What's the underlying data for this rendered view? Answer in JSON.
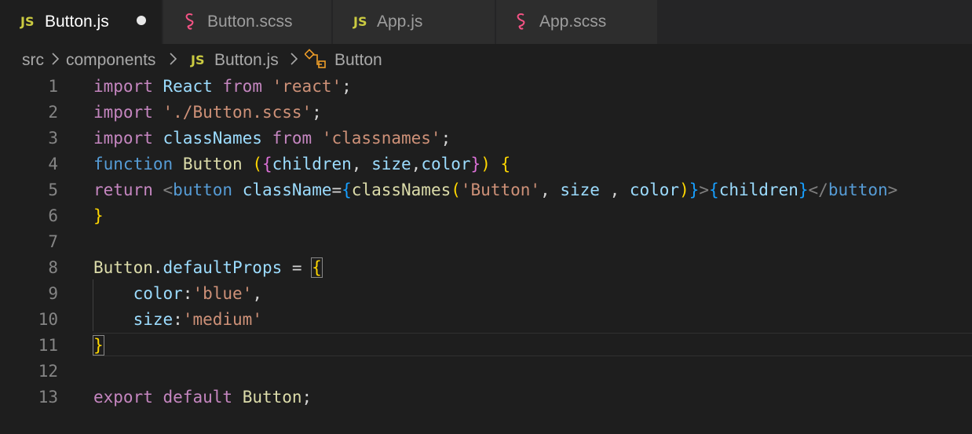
{
  "tabs": [
    {
      "label": "Button.js",
      "icon": "js-icon",
      "active": true,
      "modified": true,
      "icon_text": "JS"
    },
    {
      "label": "Button.scss",
      "icon": "scss-icon",
      "active": false
    },
    {
      "label": "App.js",
      "icon": "js-icon",
      "active": false,
      "icon_text": "JS"
    },
    {
      "label": "App.scss",
      "icon": "scss-icon",
      "active": false
    }
  ],
  "breadcrumb": {
    "parts": [
      "src",
      "components",
      "Button.js",
      "Button"
    ],
    "file_icon_text": "JS"
  },
  "editor": {
    "line_numbers": [
      "1",
      "2",
      "3",
      "4",
      "5",
      "6",
      "7",
      "8",
      "9",
      "10",
      "11",
      "12",
      "13"
    ],
    "lines": [
      [
        [
          "kw",
          "import"
        ],
        [
          "pun",
          " "
        ],
        [
          "var",
          "React"
        ],
        [
          "pun",
          " "
        ],
        [
          "kw",
          "from"
        ],
        [
          "pun",
          " "
        ],
        [
          "str",
          "'react'"
        ],
        [
          "pun",
          ";"
        ]
      ],
      [
        [
          "kw",
          "import"
        ],
        [
          "pun",
          " "
        ],
        [
          "str",
          "'./Button.scss'"
        ],
        [
          "pun",
          ";"
        ]
      ],
      [
        [
          "kw",
          "import"
        ],
        [
          "pun",
          " "
        ],
        [
          "var",
          "classNames"
        ],
        [
          "pun",
          " "
        ],
        [
          "kw",
          "from"
        ],
        [
          "pun",
          " "
        ],
        [
          "str",
          "'classnames'"
        ],
        [
          "pun",
          ";"
        ]
      ],
      [
        [
          "kw2",
          "function"
        ],
        [
          "pun",
          " "
        ],
        [
          "fn",
          "Button"
        ],
        [
          "pun",
          " "
        ],
        [
          "br1",
          "("
        ],
        [
          "br2",
          "{"
        ],
        [
          "var",
          "children"
        ],
        [
          "pun",
          ", "
        ],
        [
          "var",
          "size"
        ],
        [
          "pun",
          ","
        ],
        [
          "var",
          "color"
        ],
        [
          "br2",
          "}"
        ],
        [
          "br1",
          ")"
        ],
        [
          "pun",
          " "
        ],
        [
          "br1",
          "{"
        ]
      ],
      [
        [
          "kw",
          "return"
        ],
        [
          "pun",
          " "
        ],
        [
          "tagb",
          "<"
        ],
        [
          "tag",
          "button"
        ],
        [
          "pun",
          " "
        ],
        [
          "var",
          "className"
        ],
        [
          "pun",
          "="
        ],
        [
          "br3",
          "{"
        ],
        [
          "fn",
          "classNames"
        ],
        [
          "br1",
          "("
        ],
        [
          "str",
          "'Button'"
        ],
        [
          "pun",
          ", "
        ],
        [
          "var",
          "size"
        ],
        [
          "pun",
          " , "
        ],
        [
          "var",
          "color"
        ],
        [
          "br1",
          ")"
        ],
        [
          "br3",
          "}"
        ],
        [
          "tagb",
          ">"
        ],
        [
          "br3",
          "{"
        ],
        [
          "var",
          "children"
        ],
        [
          "br3",
          "}"
        ],
        [
          "tagb",
          "</"
        ],
        [
          "tag",
          "button"
        ],
        [
          "tagb",
          ">"
        ]
      ],
      [
        [
          "br1",
          "}"
        ]
      ],
      [],
      [
        [
          "fn",
          "Button"
        ],
        [
          "pun",
          "."
        ],
        [
          "var",
          "defaultProps"
        ],
        [
          "pun",
          " = "
        ],
        [
          "br1m",
          "{"
        ]
      ],
      [
        [
          "pun",
          "    "
        ],
        [
          "var",
          "color"
        ],
        [
          "pun",
          ":"
        ],
        [
          "str",
          "'blue'"
        ],
        [
          "pun",
          ","
        ]
      ],
      [
        [
          "pun",
          "    "
        ],
        [
          "var",
          "size"
        ],
        [
          "pun",
          ":"
        ],
        [
          "str",
          "'medium'"
        ]
      ],
      [
        [
          "br1m",
          "}"
        ]
      ],
      [],
      [
        [
          "kw",
          "export"
        ],
        [
          "pun",
          " "
        ],
        [
          "kw",
          "default"
        ],
        [
          "pun",
          " "
        ],
        [
          "fn",
          "Button"
        ],
        [
          "pun",
          ";"
        ]
      ]
    ],
    "current_line": 11
  },
  "colors": {
    "background": "#1e1e1e",
    "tab_inactive": "#2d2d2d",
    "js_icon": "#cbcb41",
    "scss_icon": "#f55385",
    "keyword": "#c586c0",
    "variable": "#9cdcfe",
    "function": "#dcdcaa",
    "string": "#ce9178"
  }
}
